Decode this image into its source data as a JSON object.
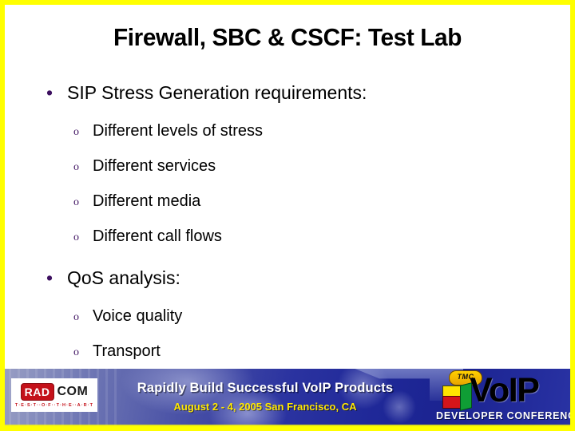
{
  "slide": {
    "title": "Firewall, SBC & CSCF: Test Lab",
    "border_color": "#ffff00",
    "background_color": "#ffffff",
    "bullet_color": "#3d1060",
    "text_color": "#000000"
  },
  "content": {
    "bullets": [
      {
        "level": 1,
        "marker": "•",
        "text": "SIP Stress Generation requirements:"
      },
      {
        "level": 2,
        "marker": "o",
        "text": "Different levels of stress"
      },
      {
        "level": 2,
        "marker": "o",
        "text": "Different services"
      },
      {
        "level": 2,
        "marker": "o",
        "text": "Different media"
      },
      {
        "level": 2,
        "marker": "o",
        "text": "Different call flows"
      },
      {
        "level": 1,
        "marker": "•",
        "text": "Qo S analysis:"
      },
      {
        "level": 2,
        "marker": "o",
        "text": "Voice quality"
      },
      {
        "level": 2,
        "marker": "o",
        "text": "Transport"
      }
    ],
    "bullet_items": {
      "b0_marker": "•",
      "b0_text": "SIP Stress Generation requirements:",
      "b1_marker": "o",
      "b1_text": "Different levels of stress",
      "b2_marker": "o",
      "b2_text": "Different services",
      "b3_marker": "o",
      "b3_text": "Different media",
      "b4_marker": "o",
      "b4_text": "Different call flows",
      "b5_marker": "•",
      "b5_text": "QoS analysis:",
      "b6_marker": "o",
      "b6_text": "Voice quality",
      "b7_marker": "o",
      "b7_text": "Transport"
    }
  },
  "footer_banner": {
    "headline": "Rapidly Build Successful VoIP Products",
    "subline": "August 2 - 4, 2005 San Francisco, CA",
    "headline_color": "#ffffff",
    "subline_color": "#ffe800",
    "background_color": "#2b33a0",
    "radcom_logo": {
      "mark_text": "RAD",
      "word_text": "COM",
      "tagline": "T·E·S·T··O·F··T·H·E··A·R·T",
      "mark_color": "#c4111a",
      "word_color": "#1a1a1a"
    },
    "voip_logo": {
      "badge": "TMC",
      "wordmark": "VoIP",
      "subtitle": "DEVELOPER CONFERENCE",
      "trademark": "™",
      "bar_colors": [
        "#ffe400",
        "#d4151a",
        "#0f9d35"
      ]
    }
  }
}
